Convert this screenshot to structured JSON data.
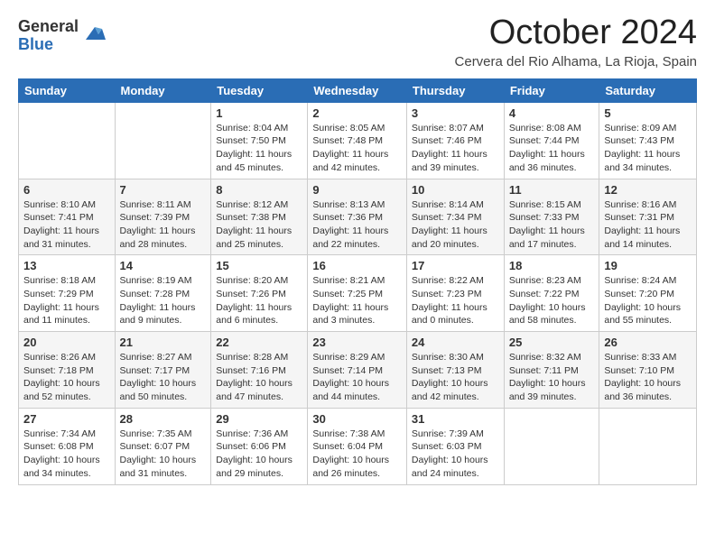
{
  "header": {
    "logo_general": "General",
    "logo_blue": "Blue",
    "month_title": "October 2024",
    "location": "Cervera del Rio Alhama, La Rioja, Spain"
  },
  "weekdays": [
    "Sunday",
    "Monday",
    "Tuesday",
    "Wednesday",
    "Thursday",
    "Friday",
    "Saturday"
  ],
  "weeks": [
    [
      {
        "day": "",
        "info": ""
      },
      {
        "day": "",
        "info": ""
      },
      {
        "day": "1",
        "info": "Sunrise: 8:04 AM\nSunset: 7:50 PM\nDaylight: 11 hours and 45 minutes."
      },
      {
        "day": "2",
        "info": "Sunrise: 8:05 AM\nSunset: 7:48 PM\nDaylight: 11 hours and 42 minutes."
      },
      {
        "day": "3",
        "info": "Sunrise: 8:07 AM\nSunset: 7:46 PM\nDaylight: 11 hours and 39 minutes."
      },
      {
        "day": "4",
        "info": "Sunrise: 8:08 AM\nSunset: 7:44 PM\nDaylight: 11 hours and 36 minutes."
      },
      {
        "day": "5",
        "info": "Sunrise: 8:09 AM\nSunset: 7:43 PM\nDaylight: 11 hours and 34 minutes."
      }
    ],
    [
      {
        "day": "6",
        "info": "Sunrise: 8:10 AM\nSunset: 7:41 PM\nDaylight: 11 hours and 31 minutes."
      },
      {
        "day": "7",
        "info": "Sunrise: 8:11 AM\nSunset: 7:39 PM\nDaylight: 11 hours and 28 minutes."
      },
      {
        "day": "8",
        "info": "Sunrise: 8:12 AM\nSunset: 7:38 PM\nDaylight: 11 hours and 25 minutes."
      },
      {
        "day": "9",
        "info": "Sunrise: 8:13 AM\nSunset: 7:36 PM\nDaylight: 11 hours and 22 minutes."
      },
      {
        "day": "10",
        "info": "Sunrise: 8:14 AM\nSunset: 7:34 PM\nDaylight: 11 hours and 20 minutes."
      },
      {
        "day": "11",
        "info": "Sunrise: 8:15 AM\nSunset: 7:33 PM\nDaylight: 11 hours and 17 minutes."
      },
      {
        "day": "12",
        "info": "Sunrise: 8:16 AM\nSunset: 7:31 PM\nDaylight: 11 hours and 14 minutes."
      }
    ],
    [
      {
        "day": "13",
        "info": "Sunrise: 8:18 AM\nSunset: 7:29 PM\nDaylight: 11 hours and 11 minutes."
      },
      {
        "day": "14",
        "info": "Sunrise: 8:19 AM\nSunset: 7:28 PM\nDaylight: 11 hours and 9 minutes."
      },
      {
        "day": "15",
        "info": "Sunrise: 8:20 AM\nSunset: 7:26 PM\nDaylight: 11 hours and 6 minutes."
      },
      {
        "day": "16",
        "info": "Sunrise: 8:21 AM\nSunset: 7:25 PM\nDaylight: 11 hours and 3 minutes."
      },
      {
        "day": "17",
        "info": "Sunrise: 8:22 AM\nSunset: 7:23 PM\nDaylight: 11 hours and 0 minutes."
      },
      {
        "day": "18",
        "info": "Sunrise: 8:23 AM\nSunset: 7:22 PM\nDaylight: 10 hours and 58 minutes."
      },
      {
        "day": "19",
        "info": "Sunrise: 8:24 AM\nSunset: 7:20 PM\nDaylight: 10 hours and 55 minutes."
      }
    ],
    [
      {
        "day": "20",
        "info": "Sunrise: 8:26 AM\nSunset: 7:18 PM\nDaylight: 10 hours and 52 minutes."
      },
      {
        "day": "21",
        "info": "Sunrise: 8:27 AM\nSunset: 7:17 PM\nDaylight: 10 hours and 50 minutes."
      },
      {
        "day": "22",
        "info": "Sunrise: 8:28 AM\nSunset: 7:16 PM\nDaylight: 10 hours and 47 minutes."
      },
      {
        "day": "23",
        "info": "Sunrise: 8:29 AM\nSunset: 7:14 PM\nDaylight: 10 hours and 44 minutes."
      },
      {
        "day": "24",
        "info": "Sunrise: 8:30 AM\nSunset: 7:13 PM\nDaylight: 10 hours and 42 minutes."
      },
      {
        "day": "25",
        "info": "Sunrise: 8:32 AM\nSunset: 7:11 PM\nDaylight: 10 hours and 39 minutes."
      },
      {
        "day": "26",
        "info": "Sunrise: 8:33 AM\nSunset: 7:10 PM\nDaylight: 10 hours and 36 minutes."
      }
    ],
    [
      {
        "day": "27",
        "info": "Sunrise: 7:34 AM\nSunset: 6:08 PM\nDaylight: 10 hours and 34 minutes."
      },
      {
        "day": "28",
        "info": "Sunrise: 7:35 AM\nSunset: 6:07 PM\nDaylight: 10 hours and 31 minutes."
      },
      {
        "day": "29",
        "info": "Sunrise: 7:36 AM\nSunset: 6:06 PM\nDaylight: 10 hours and 29 minutes."
      },
      {
        "day": "30",
        "info": "Sunrise: 7:38 AM\nSunset: 6:04 PM\nDaylight: 10 hours and 26 minutes."
      },
      {
        "day": "31",
        "info": "Sunrise: 7:39 AM\nSunset: 6:03 PM\nDaylight: 10 hours and 24 minutes."
      },
      {
        "day": "",
        "info": ""
      },
      {
        "day": "",
        "info": ""
      }
    ]
  ]
}
